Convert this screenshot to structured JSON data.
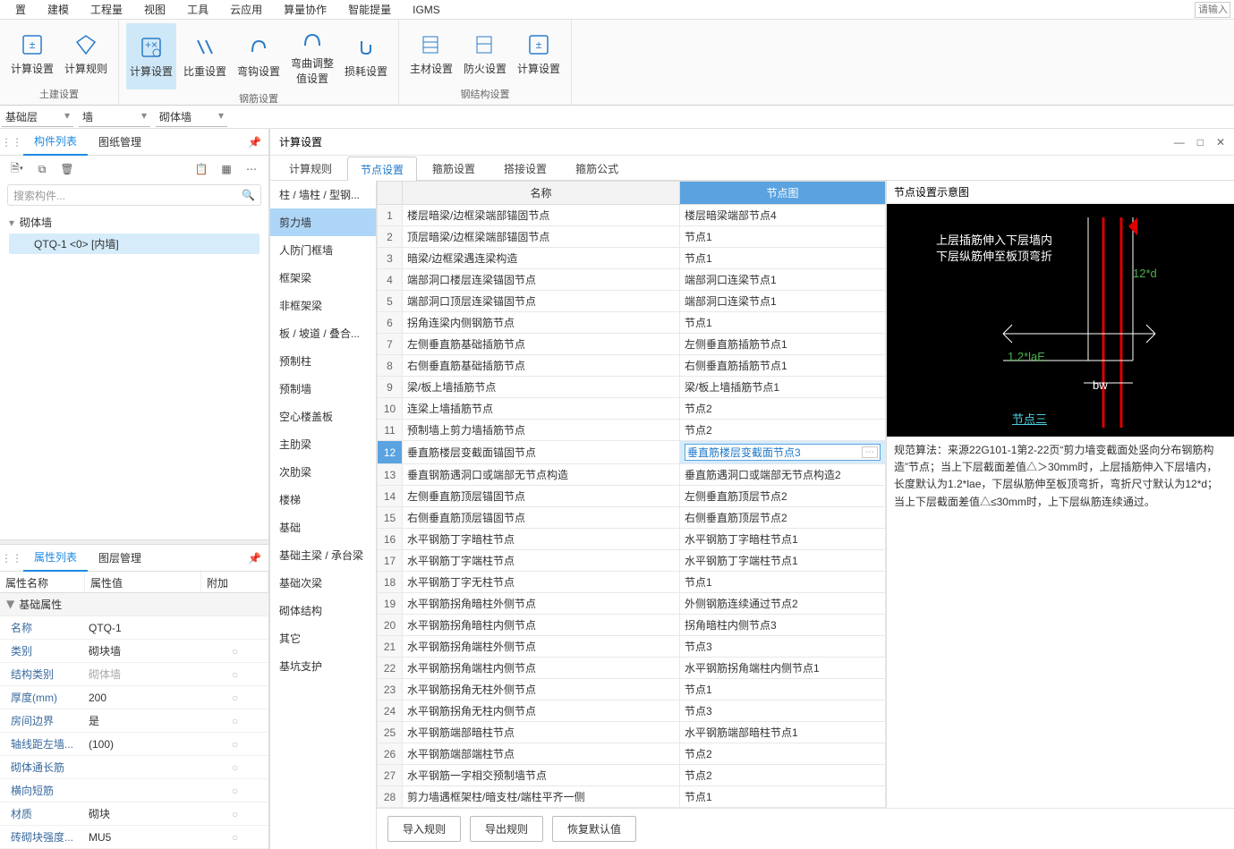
{
  "menubar": [
    "置",
    "建模",
    "工程量",
    "视图",
    "工具",
    "云应用",
    "算量协作",
    "智能提量",
    "IGMS"
  ],
  "search_placeholder": "请输入",
  "ribbon": {
    "groups": [
      {
        "name": "土建设置",
        "buttons": [
          {
            "label": "计算设置"
          },
          {
            "label": "计算规则"
          }
        ]
      },
      {
        "name": "钢筋设置",
        "buttons": [
          {
            "label": "计算设置",
            "active": true
          },
          {
            "label": "比重设置"
          },
          {
            "label": "弯钩设置"
          },
          {
            "label": "弯曲调整值设置"
          },
          {
            "label": "损耗设置"
          }
        ]
      },
      {
        "name": "钢结构设置",
        "buttons": [
          {
            "label": "主材设置"
          },
          {
            "label": "防火设置"
          },
          {
            "label": "计算设置"
          }
        ]
      }
    ]
  },
  "selectors": {
    "floor": "基础层",
    "category": "墙",
    "sub": "砌体墙"
  },
  "left_tabs": {
    "components": "构件列表",
    "drawings": "图纸管理"
  },
  "search_inst_placeholder": "搜索构件...",
  "tree": {
    "root": "砌体墙",
    "leaf": "QTQ-1 <0> [内墙]"
  },
  "prop_tabs": {
    "props": "属性列表",
    "layers": "图层管理"
  },
  "prop_header": {
    "name": "属性名称",
    "value": "属性值",
    "extra": "附加"
  },
  "prop_section": "基础属性",
  "props": [
    {
      "k": "名称",
      "v": "QTQ-1"
    },
    {
      "k": "类别",
      "v": "砌块墙",
      "a": true
    },
    {
      "k": "结构类别",
      "v": "砌体墙",
      "gray": true,
      "a": true
    },
    {
      "k": "厚度(mm)",
      "v": "200",
      "a": true
    },
    {
      "k": "房间边界",
      "v": "是",
      "a": true
    },
    {
      "k": "轴线距左墙...",
      "v": "(100)",
      "a": true
    },
    {
      "k": "砌体通长筋",
      "v": "",
      "a": true
    },
    {
      "k": "横向短筋",
      "v": "",
      "a": true
    },
    {
      "k": "材质",
      "v": "砌块",
      "a": true
    },
    {
      "k": "砖砌块强度...",
      "v": "MU5",
      "a": true
    }
  ],
  "dialog": {
    "title": "计算设置",
    "tabs": [
      "计算规则",
      "节点设置",
      "箍筋设置",
      "搭接设置",
      "箍筋公式"
    ],
    "active_tab": 1,
    "categories": [
      "柱 / 墙柱 / 型钢...",
      "剪力墙",
      "人防门框墙",
      "框架梁",
      "非框架梁",
      "板 / 坡道 / 叠合...",
      "预制柱",
      "预制墙",
      "空心楼盖板",
      "主肋梁",
      "次肋梁",
      "楼梯",
      "基础",
      "基础主梁 / 承台梁",
      "基础次梁",
      "砌体结构",
      "其它",
      "基坑支护"
    ],
    "active_category": 1,
    "table_header": {
      "name": "名称",
      "node": "节点图"
    },
    "rows": [
      {
        "n": "1",
        "name": "楼层暗梁/边框梁端部锚固节点",
        "node": "楼层暗梁端部节点4"
      },
      {
        "n": "2",
        "name": "顶层暗梁/边框梁端部锚固节点",
        "node": "节点1"
      },
      {
        "n": "3",
        "name": "暗梁/边框梁遇连梁构造",
        "node": "节点1"
      },
      {
        "n": "4",
        "name": "端部洞口楼层连梁锚固节点",
        "node": "端部洞口连梁节点1"
      },
      {
        "n": "5",
        "name": "端部洞口顶层连梁锚固节点",
        "node": "端部洞口连梁节点1"
      },
      {
        "n": "6",
        "name": "拐角连梁内侧钢筋节点",
        "node": "节点1"
      },
      {
        "n": "7",
        "name": "左侧垂直筋基础插筋节点",
        "node": "左侧垂直筋插筋节点1"
      },
      {
        "n": "8",
        "name": "右侧垂直筋基础插筋节点",
        "node": "右侧垂直筋插筋节点1"
      },
      {
        "n": "9",
        "name": "梁/板上墙插筋节点",
        "node": "梁/板上墙插筋节点1"
      },
      {
        "n": "10",
        "name": "连梁上墙插筋节点",
        "node": "节点2"
      },
      {
        "n": "11",
        "name": "预制墙上剪力墙插筋节点",
        "node": "节点2"
      },
      {
        "n": "12",
        "name": "垂直筋楼层变截面锚固节点",
        "node": "垂直筋楼层变截面节点3",
        "sel": true
      },
      {
        "n": "13",
        "name": "垂直钢筋遇洞口或端部无节点构造",
        "node": "垂直筋遇洞口或端部无节点构造2"
      },
      {
        "n": "14",
        "name": "左侧垂直筋顶层锚固节点",
        "node": "左侧垂直筋顶层节点2"
      },
      {
        "n": "15",
        "name": "右侧垂直筋顶层锚固节点",
        "node": "右侧垂直筋顶层节点2"
      },
      {
        "n": "16",
        "name": "水平钢筋丁字暗柱节点",
        "node": "水平钢筋丁字暗柱节点1"
      },
      {
        "n": "17",
        "name": "水平钢筋丁字端柱节点",
        "node": "水平钢筋丁字端柱节点1"
      },
      {
        "n": "18",
        "name": "水平钢筋丁字无柱节点",
        "node": "节点1"
      },
      {
        "n": "19",
        "name": "水平钢筋拐角暗柱外侧节点",
        "node": "外侧钢筋连续通过节点2"
      },
      {
        "n": "20",
        "name": "水平钢筋拐角暗柱内侧节点",
        "node": "拐角暗柱内侧节点3"
      },
      {
        "n": "21",
        "name": "水平钢筋拐角端柱外侧节点",
        "node": "节点3"
      },
      {
        "n": "22",
        "name": "水平钢筋拐角端柱内侧节点",
        "node": "水平钢筋拐角端柱内侧节点1"
      },
      {
        "n": "23",
        "name": "水平钢筋拐角无柱外侧节点",
        "node": "节点1"
      },
      {
        "n": "24",
        "name": "水平钢筋拐角无柱内侧节点",
        "node": "节点3"
      },
      {
        "n": "25",
        "name": "水平钢筋端部暗柱节点",
        "node": "水平钢筋端部暗柱节点1"
      },
      {
        "n": "26",
        "name": "水平钢筋端部端柱节点",
        "node": "节点2"
      },
      {
        "n": "27",
        "name": "水平钢筋一字相交预制墙节点",
        "node": "节点2"
      },
      {
        "n": "28",
        "name": "剪力墙遇框架柱/暗支柱/端柱平齐一侧",
        "node": "节点1"
      }
    ],
    "preview_title": "节点设置示意图",
    "diagram": {
      "line1": "上层插筋伸入下层墙内",
      "line2": "下层纵筋伸至板顶弯折",
      "dim1": "12*d",
      "dim2": "1.2*laE",
      "dim3": "bw",
      "link": "节点三"
    },
    "desc": "规范算法：来源22G101-1第2-22页“剪力墙变截面处竖向分布钢筋构造”节点；当上下层截面差值△＞30mm时，上层插筋伸入下层墙内，长度默认为1.2*lae，下层纵筋伸至板顶弯折，弯折尺寸默认为12*d；当上下层截面差值△≤30mm时，上下层纵筋连续通过。",
    "footer_btns": [
      "导入规则",
      "导出规则",
      "恢复默认值"
    ]
  }
}
